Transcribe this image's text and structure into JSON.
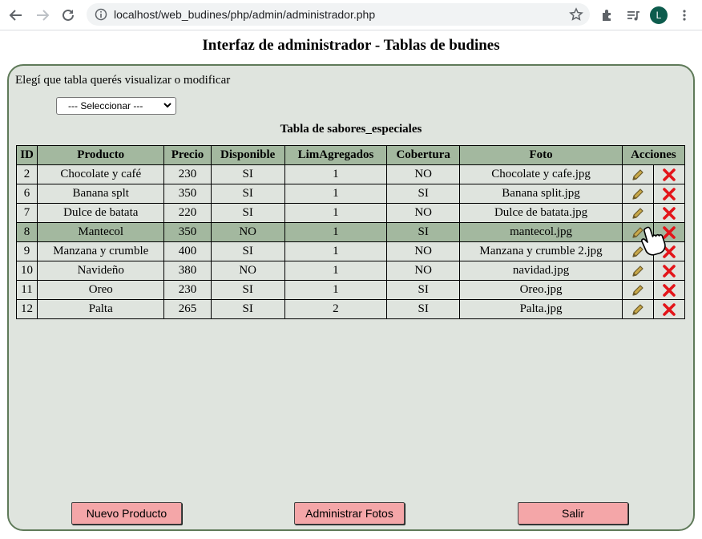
{
  "browser": {
    "url": "localhost/web_budines/php/admin/administrador.php",
    "avatar_letter": "L"
  },
  "page": {
    "title": "Interfaz de administrador - Tablas de budines",
    "prompt": "Elegí que tabla querés visualizar o modificar",
    "select_value": "--- Seleccionar ---",
    "table_title": "Tabla de sabores_especiales"
  },
  "table": {
    "headers": [
      "ID",
      "Producto",
      "Precio",
      "Disponible",
      "LimAgregados",
      "Cobertura",
      "Foto",
      "Acciones"
    ],
    "rows": [
      {
        "id": "2",
        "producto": "Chocolate y café",
        "precio": "230",
        "disponible": "SI",
        "lim": "1",
        "cobertura": "NO",
        "foto": "Chocolate y cafe.jpg"
      },
      {
        "id": "6",
        "producto": "Banana splt",
        "precio": "350",
        "disponible": "SI",
        "lim": "1",
        "cobertura": "SI",
        "foto": "Banana split.jpg"
      },
      {
        "id": "7",
        "producto": "Dulce de batata",
        "precio": "220",
        "disponible": "SI",
        "lim": "1",
        "cobertura": "NO",
        "foto": "Dulce de batata.jpg"
      },
      {
        "id": "8",
        "producto": "Mantecol",
        "precio": "350",
        "disponible": "NO",
        "lim": "1",
        "cobertura": "SI",
        "foto": "mantecol.jpg"
      },
      {
        "id": "9",
        "producto": "Manzana y crumble",
        "precio": "400",
        "disponible": "SI",
        "lim": "1",
        "cobertura": "NO",
        "foto": "Manzana y crumble 2.jpg"
      },
      {
        "id": "10",
        "producto": "Navideño",
        "precio": "380",
        "disponible": "NO",
        "lim": "1",
        "cobertura": "NO",
        "foto": "navidad.jpg"
      },
      {
        "id": "11",
        "producto": "Oreo",
        "precio": "230",
        "disponible": "SI",
        "lim": "1",
        "cobertura": "SI",
        "foto": "Oreo.jpg"
      },
      {
        "id": "12",
        "producto": "Palta",
        "precio": "265",
        "disponible": "SI",
        "lim": "2",
        "cobertura": "SI",
        "foto": "Palta.jpg"
      }
    ],
    "highlighted_row": 3,
    "edit_icon": "pencil-icon",
    "delete_icon": "red-x-icon"
  },
  "buttons": {
    "new_product": "Nuevo Producto",
    "manage_photos": "Administrar Fotos",
    "exit": "Salir"
  },
  "colors": {
    "panel_bg": "#dfe4de",
    "panel_border": "#5f7a59",
    "header_bg": "#a3b89f",
    "button_bg": "#f4a6a8",
    "delete_red": "#e3151a"
  }
}
